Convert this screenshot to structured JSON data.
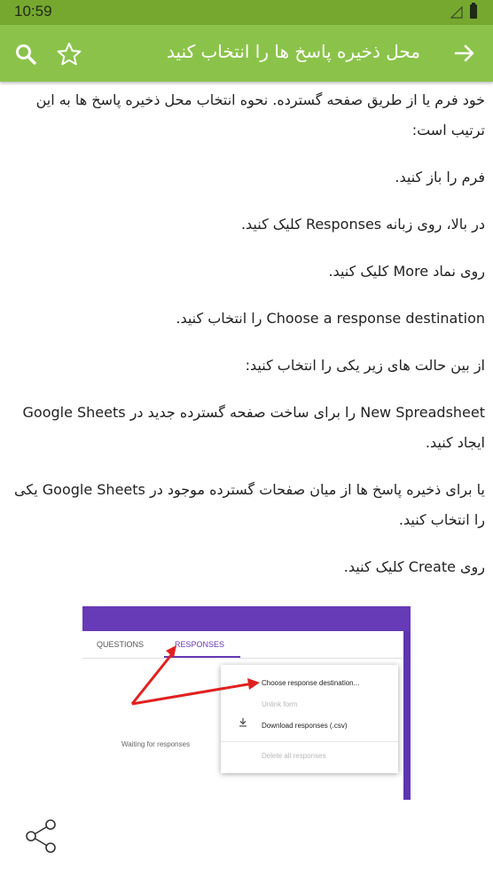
{
  "status_bar": {
    "time": "10:59"
  },
  "app_bar": {
    "title": "محل ذخیره پاسخ ها را انتخاب کنید",
    "back_icon": "arrow-right-icon",
    "favorite_icon": "star-outline-icon",
    "search_icon": "search-icon",
    "color": "#8bc34a"
  },
  "article": {
    "paragraphs": [
      "خود فرم یا از طریق صفحه گسترده. نحوه انتخاب محل ذخیره پاسخ ها به این ترتیب است:",
      "فرم را باز کنید.",
      "در بالا، روی زبانه Responses کلیک کنید.",
      "روی نماد More کلیک کنید.",
      "Choose a response destination را انتخاب کنید.",
      "از بین حالت های زیر یکی را انتخاب کنید:",
      "New Spreadsheet را برای ساخت صفحه گسترده جدید در Google Sheets ایجاد کنید.",
      "یا برای ذخیره پاسخ ها از میان صفحات گسترده موجود در Google Sheets یکی را انتخاب کنید.",
      "روی Create کلیک کنید."
    ]
  },
  "screenshot": {
    "tab_questions": "QUESTIONS",
    "tab_responses": "RESPONSES",
    "waiting": "Waiting for responses",
    "menu": {
      "choose": "Choose response destination...",
      "unlink": "Unlink form",
      "download": "Download responses (.csv)",
      "delete": "Delete all responses"
    }
  },
  "share_icon": "share-icon"
}
